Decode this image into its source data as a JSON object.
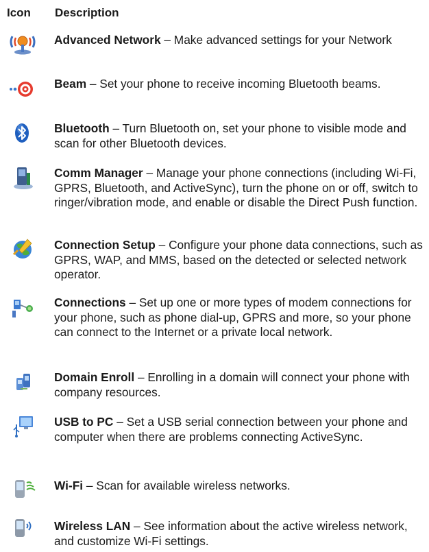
{
  "table": {
    "header": {
      "icon": "Icon",
      "description": "Description"
    },
    "rows": [
      {
        "icon": "advanced-network-icon",
        "name": "Advanced Network",
        "sep": " – ",
        "text": "Make advanced settings for your Network"
      },
      {
        "icon": "beam-icon",
        "name": "Beam",
        "sep": " – ",
        "text": "Set your phone to receive incoming Bluetooth beams."
      },
      {
        "icon": "bluetooth-icon",
        "name": "Bluetooth",
        "sep": " – ",
        "text": "Turn Bluetooth on, set your phone to visible mode and scan for other Bluetooth devices."
      },
      {
        "icon": "comm-manager-icon",
        "name": "Comm Manager",
        "sep": " – ",
        "text": "Manage your phone connections (including Wi-Fi, GPRS, Bluetooth, and ActiveSync), turn the phone on or off, switch to ringer/vibration mode, and enable or disable the Direct Push function."
      },
      {
        "icon": "connection-setup-icon",
        "name": "Connection Setup",
        "sep": " – ",
        "text": "Configure your phone data connections, such as GPRS, WAP, and MMS, based on the detected or selected network operator."
      },
      {
        "icon": "connections-icon",
        "name": "Connections",
        "sep": " – ",
        "text": "Set up one or more types of modem connections for your phone, such as phone dial-up, GPRS and more, so your phone can connect to the Internet or a private local network."
      },
      {
        "icon": "domain-enroll-icon",
        "name": "Domain Enroll",
        "sep": " – ",
        "text": "Enrolling in a domain will connect your phone with company resources."
      },
      {
        "icon": "usb-to-pc-icon",
        "name": "USB to PC",
        "sep": " – ",
        "text": "Set a USB serial connection between your phone and computer when there are problems connecting ActiveSync."
      },
      {
        "icon": "wi-fi-icon",
        "name": "Wi-Fi",
        "sep": " – ",
        "text": "Scan for available wireless networks."
      },
      {
        "icon": "wireless-lan-icon",
        "name": "Wireless LAN",
        "sep": " – ",
        "text": "See information about the active wireless network, and customize Wi-Fi settings."
      }
    ]
  }
}
